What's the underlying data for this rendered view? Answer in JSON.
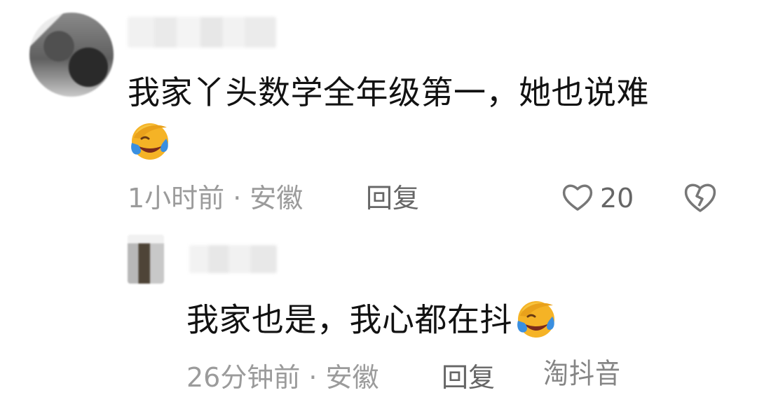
{
  "comment": {
    "text": "我家丫头数学全年级第一，她也说难",
    "emoji": "facepalm-laugh-emoji",
    "time": "1小时前",
    "location": "安徽",
    "reply_label": "回复",
    "likes": "20"
  },
  "reply": {
    "text": "我家也是，我心都在抖",
    "emoji": "facepalm-laugh-emoji",
    "time": "26分钟前",
    "location": "安徽",
    "reply_label": "回复"
  },
  "watermark": "淘抖音",
  "icons": {
    "like": "heart-outline-icon",
    "dislike": "broken-heart-icon"
  },
  "colors": {
    "text": "#121212",
    "meta": "#9b9b9b",
    "emoji_yellow": "#f5b326",
    "emoji_tear": "#3a8fe0"
  }
}
